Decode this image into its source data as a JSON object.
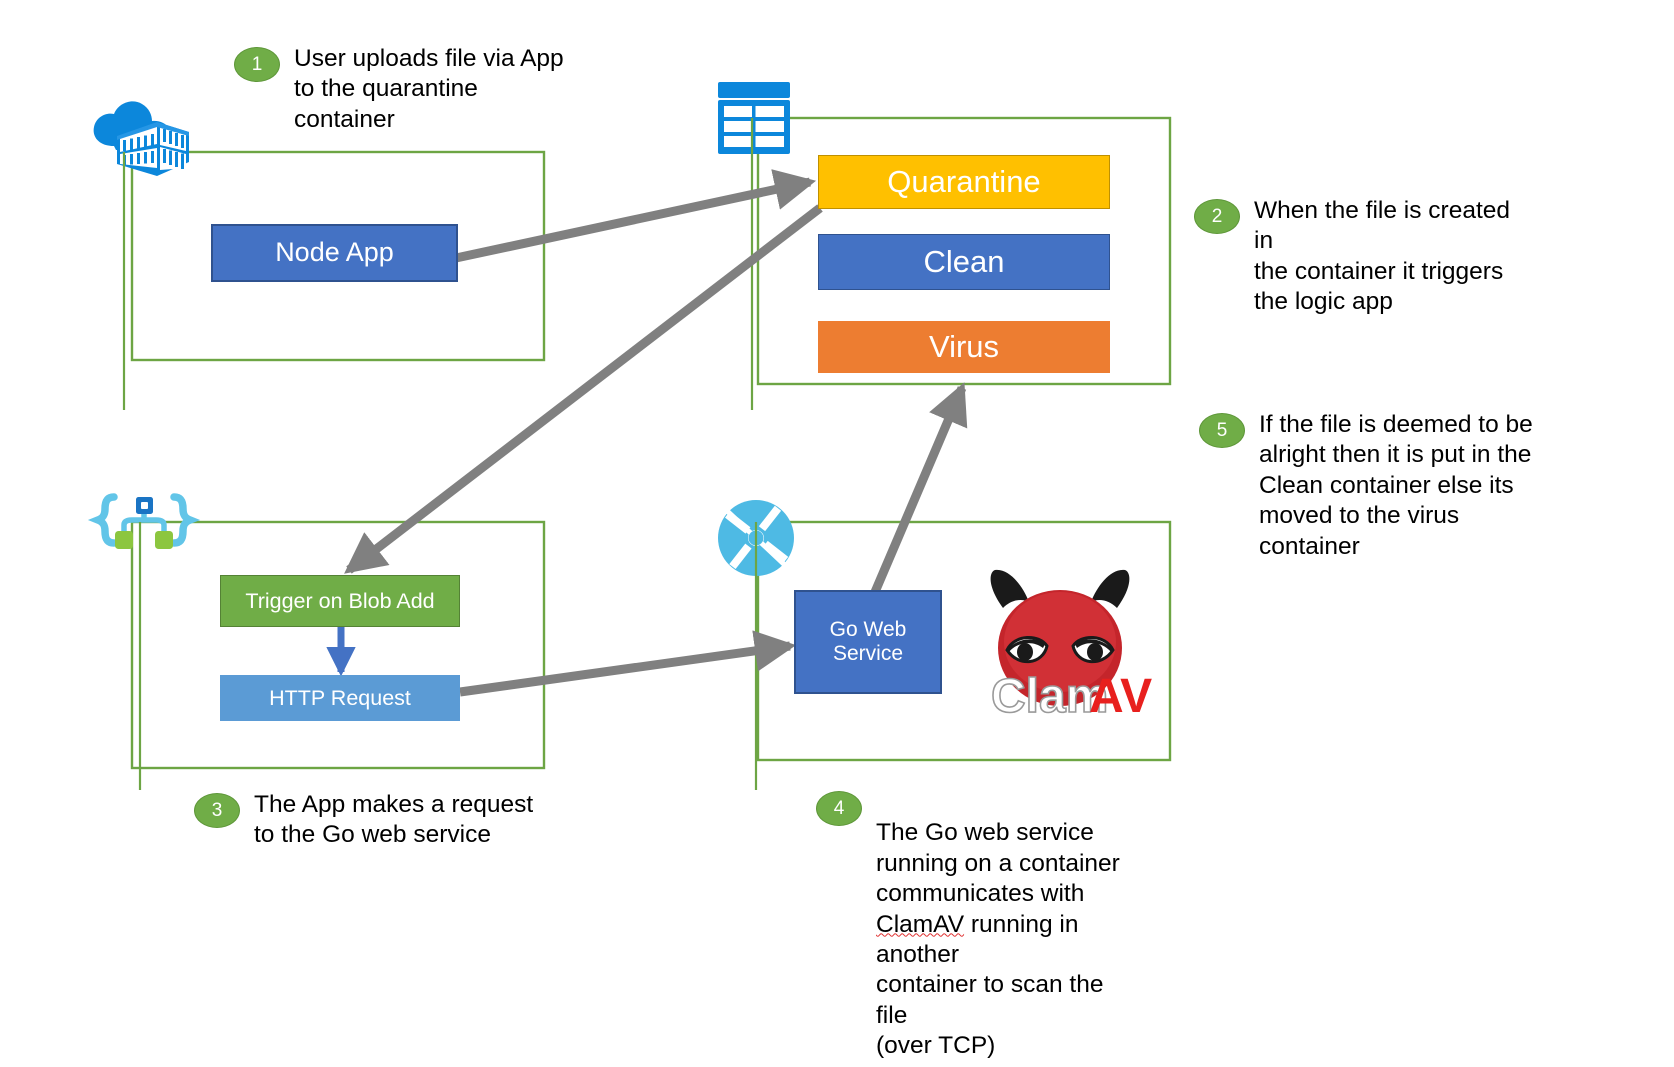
{
  "diagram": {
    "title": "Azure file upload virus-scanning architecture",
    "colors": {
      "group_border": "#6DA544",
      "quarantine": "#FFC000",
      "clean": "#4472C4",
      "virus": "#ED7D31",
      "node_app": "#4472C4",
      "trigger": "#70AD47",
      "http": "#5B9BD5",
      "go_web_service": "#4472C4",
      "badge": "#70AD47",
      "arrow": "#808080",
      "arrow_blue": "#4472C4",
      "azure_blue": "#0078D4",
      "logic_app_blue": "#50C0E8",
      "clamav_red": "#C4252B"
    },
    "groups": [
      {
        "name": "app-service-group",
        "icon": "azure-app-service-icon"
      },
      {
        "name": "storage-account-group",
        "icon": "azure-storage-table-icon"
      },
      {
        "name": "logic-app-group",
        "icon": "azure-logic-app-icon"
      },
      {
        "name": "container-instance-group",
        "icon": "azure-container-instance-icon"
      }
    ],
    "nodes": {
      "node_app": "Node App",
      "quarantine": "Quarantine",
      "clean": "Clean",
      "virus": "Virus",
      "trigger": "Trigger on Blob Add",
      "http_request": "HTTP Request",
      "go_web_service": "Go Web\nService"
    },
    "logos": {
      "clamav": {
        "name": "ClamAV",
        "clam": "Clam",
        "av": "AV"
      }
    },
    "callouts": [
      {
        "number": "1",
        "text": "User uploads file via App\nto the quarantine\ncontainer"
      },
      {
        "number": "2",
        "text": "When the file is created in\nthe container it triggers\nthe logic app"
      },
      {
        "number": "5",
        "text": "If the file is deemed to be\nalright then it is put in the\nClean container else its\nmoved to the virus\ncontainer"
      },
      {
        "number": "3",
        "text": "The App makes a request\nto the Go web service"
      },
      {
        "number": "4",
        "text_before": "The Go web service\nrunning on a container\ncommunicates with\n",
        "text_misspelled": "ClamAV",
        "text_after": " running in another\ncontainer to scan the file\n(over TCP)"
      }
    ],
    "arrows": [
      {
        "name": "node-app-to-quarantine",
        "from": "Node App",
        "to": "Quarantine"
      },
      {
        "name": "quarantine-to-trigger",
        "from": "Quarantine",
        "to": "Trigger on Blob Add"
      },
      {
        "name": "trigger-to-http",
        "from": "Trigger on Blob Add",
        "to": "HTTP Request"
      },
      {
        "name": "http-to-go-web-service",
        "from": "HTTP Request",
        "to": "Go Web Service"
      },
      {
        "name": "go-web-service-to-virus",
        "from": "Go Web Service",
        "to": "Virus"
      }
    ]
  }
}
